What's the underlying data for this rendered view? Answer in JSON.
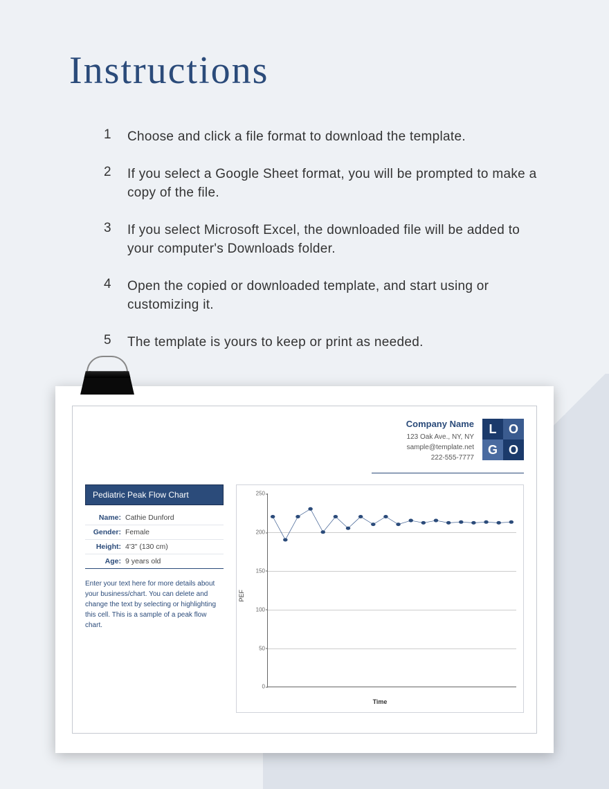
{
  "title": "Instructions",
  "instructions": [
    "Choose and click a file format to download the template.",
    "If you select a Google Sheet format, you will be prompted to make a copy of the file.",
    "If you select Microsoft Excel, the downloaded file will be added to your computer's Downloads folder.",
    "Open the copied or downloaded template, and start using or customizing it.",
    "The template is yours to keep or print as needed."
  ],
  "template": {
    "company_name": "Company Name",
    "address": "123 Oak Ave., NY, NY",
    "email": "sample@template.net",
    "phone": "222-555-7777",
    "logo_letters": [
      "L",
      "O",
      "G",
      "O"
    ],
    "badge": "Pediatric Peak Flow Chart",
    "info": {
      "name_label": "Name:",
      "name": "Cathie Dunford",
      "gender_label": "Gender:",
      "gender": "Female",
      "height_label": "Height:",
      "height": "4'3\" (130 cm)",
      "age_label": "Age:",
      "age": "9 years old"
    },
    "description": "Enter your text here for more details about your business/chart. You can delete and change the text by selecting or highlighting this cell. This is a sample of a peak flow chart."
  },
  "chart_data": {
    "type": "line",
    "title": "",
    "xlabel": "Time",
    "ylabel": "PEF",
    "ylim": [
      0,
      250
    ],
    "yticks": [
      0,
      50,
      100,
      150,
      200,
      250
    ],
    "x": [
      1,
      2,
      3,
      4,
      5,
      6,
      7,
      8,
      9,
      10,
      11,
      12,
      13,
      14,
      15,
      16,
      17,
      18,
      19,
      20
    ],
    "values": [
      220,
      190,
      220,
      230,
      200,
      220,
      205,
      220,
      210,
      220,
      210,
      215,
      212,
      215,
      212,
      213,
      212,
      213,
      212,
      213
    ]
  }
}
